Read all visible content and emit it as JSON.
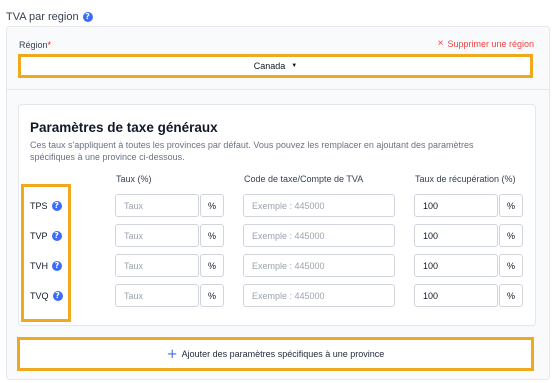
{
  "section": {
    "title": "TVA par region",
    "help_icon": "?"
  },
  "region": {
    "label": "Région",
    "required_mark": "*",
    "delete_icon": "×",
    "delete_label": "Supprimer une région",
    "selected": "Canada"
  },
  "params": {
    "title": "Paramètres de taxe généraux",
    "description": "Ces taux s'appliquent à toutes les provinces par défaut. Vous pouvez les remplacer en ajoutant des paramètres spécifiques à une province ci-dessous.",
    "columns": {
      "rate": "Taux (%)",
      "code": "Code de taxe/Compte de TVA",
      "recovery": "Taux de récupération (%)"
    },
    "rows": [
      {
        "name": "TPS",
        "rate_placeholder": "Taux",
        "percent": "%",
        "code_placeholder": "Exemple : 445000",
        "recovery": "100"
      },
      {
        "name": "TVP",
        "rate_placeholder": "Taux",
        "percent": "%",
        "code_placeholder": "Exemple : 445000",
        "recovery": "100"
      },
      {
        "name": "TVH",
        "rate_placeholder": "Taux",
        "percent": "%",
        "code_placeholder": "Exemple : 445000",
        "recovery": "100"
      },
      {
        "name": "TVQ",
        "rate_placeholder": "Taux",
        "percent": "%",
        "code_placeholder": "Exemple : 445000",
        "recovery": "100"
      }
    ]
  },
  "add_province": {
    "label": "Ajouter des paramètres spécifiques à une province",
    "icon": "+"
  },
  "colors": {
    "accent": "#3b6cf6",
    "highlight": "#f0a81e",
    "danger": "#ef4444"
  }
}
